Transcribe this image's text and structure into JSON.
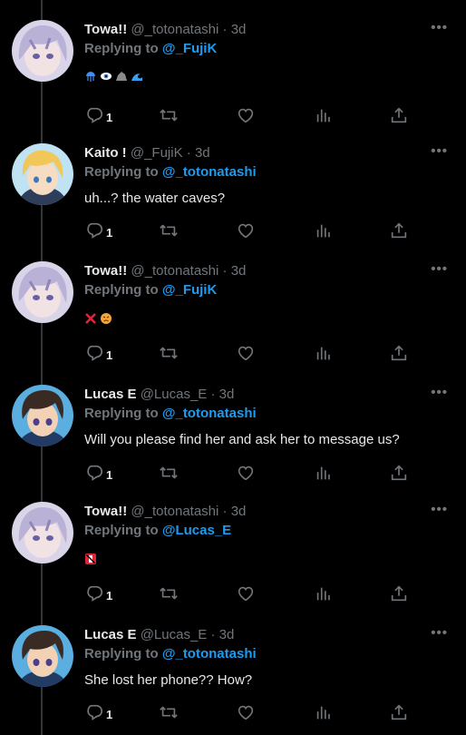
{
  "tweets": [
    {
      "name": "Towa!!",
      "handle": "@_totonatashi",
      "dot": "·",
      "time": "3d",
      "reply_prefix": "Replying to",
      "reply_to": "@_FujiK",
      "text": "",
      "emoji": "jellyfish, eye, rock, wave",
      "replies": "1",
      "avatar": "towa"
    },
    {
      "name": "Kaito !",
      "handle": "@_FujiK",
      "dot": "·",
      "time": "3d",
      "reply_prefix": "Replying to",
      "reply_to": "@_totonatashi",
      "text": "uh...? the water caves?",
      "emoji": "",
      "replies": "1",
      "avatar": "kaito"
    },
    {
      "name": "Towa!!",
      "handle": "@_totonatashi",
      "dot": "·",
      "time": "3d",
      "reply_prefix": "Replying to",
      "reply_to": "@_FujiK",
      "text": "",
      "emoji": "cross-mark, angry-face",
      "replies": "1",
      "avatar": "towa"
    },
    {
      "name": "Lucas E",
      "handle": "@Lucas_E",
      "dot": "·",
      "time": "3d",
      "reply_prefix": "Replying to",
      "reply_to": "@_totonatashi",
      "text": "Will you please find her and ask her to message us?",
      "emoji": "",
      "replies": "1",
      "avatar": "lucas"
    },
    {
      "name": "Towa!!",
      "handle": "@_totonatashi",
      "dot": "·",
      "time": "3d",
      "reply_prefix": "Replying to",
      "reply_to": "@Lucas_E",
      "text": "",
      "emoji": "no-mobile-phones",
      "replies": "1",
      "avatar": "towa"
    },
    {
      "name": "Lucas E",
      "handle": "@Lucas_E",
      "dot": "·",
      "time": "3d",
      "reply_prefix": "Replying to",
      "reply_to": "@_totonatashi",
      "text": "She lost her phone?? How?",
      "emoji": "",
      "replies": "1",
      "avatar": "lucas"
    }
  ],
  "more_label": "•••",
  "colors": {
    "background": "#000000",
    "name": "#e7e9ea",
    "muted": "#71767b",
    "link": "#1d9bf0",
    "thread_line": "#333639"
  },
  "icons": [
    "reply-icon",
    "retweet-icon",
    "like-icon",
    "views-icon",
    "share-icon",
    "more-icon"
  ]
}
